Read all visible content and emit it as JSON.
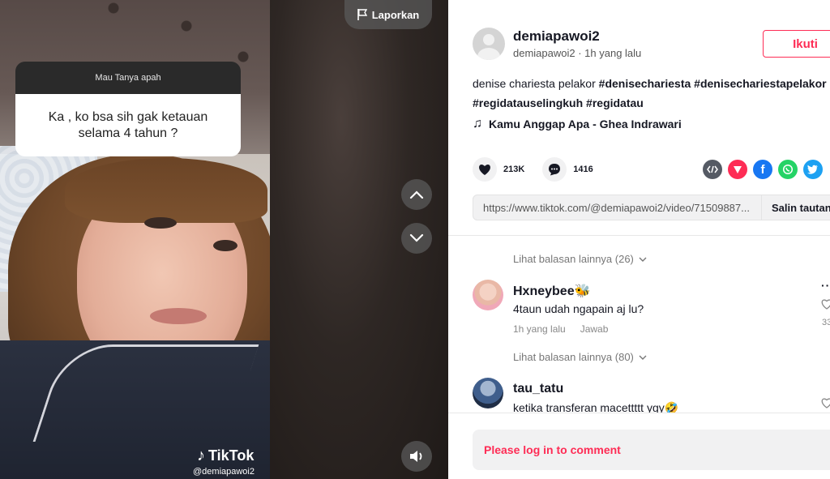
{
  "video": {
    "report_label": "Laporkan",
    "question_sticker": {
      "header": "Mau Tanya apah",
      "body": "Ka , ko bsa sih gak ketauan selama 4 tahun ?"
    },
    "watermark": {
      "logo_text": "TikTok",
      "handle": "@demiapawoi2"
    },
    "icons": {
      "report": "flag-icon",
      "prev": "chevron-up-icon",
      "next": "chevron-down-icon",
      "sound": "speaker-icon"
    }
  },
  "author": {
    "username": "demiapawoi2",
    "subline": "demiapawoi2 · 1h yang lalu",
    "follow_label": "Ikuti"
  },
  "description": {
    "text": "denise chariesta pelakor ",
    "hashtags": [
      "#denisechariesta",
      "#denisechariestapelakor",
      "#regidatauselingkuh",
      "#regidatau"
    ]
  },
  "music": {
    "title": "Kamu Anggap Apa - Ghea Indrawari",
    "icon": "music-note-icon"
  },
  "stats": {
    "likes": "213K",
    "comments": "1416"
  },
  "share": {
    "icons": [
      "embed-icon",
      "send-icon",
      "facebook-icon",
      "whatsapp-icon",
      "twitter-icon"
    ],
    "colors": {
      "embed": "#555a64",
      "send": "#fe2c55",
      "facebook": "#1877f2",
      "whatsapp": "#25d366",
      "twitter": "#1da1f2"
    }
  },
  "link": {
    "url": "https://www.tiktok.com/@demiapawoi2/video/71509887...",
    "copy_label": "Salin tautan"
  },
  "comments": {
    "thread_1_more": "Lihat balasan lainnya (26)",
    "items": [
      {
        "username": "Hxneybee🐝",
        "text": "4taun udah ngapain aj lu?",
        "time": "1h yang lalu",
        "reply_label": "Jawab",
        "likes": "33",
        "more_replies": "Lihat balasan lainnya (80)"
      },
      {
        "username": "tau_tatu",
        "text": "ketika transferan macettttt ygy🤣"
      }
    ]
  },
  "login_prompt": "Please log in to comment",
  "colors": {
    "accent": "#fe2c55",
    "text": "#161823"
  }
}
